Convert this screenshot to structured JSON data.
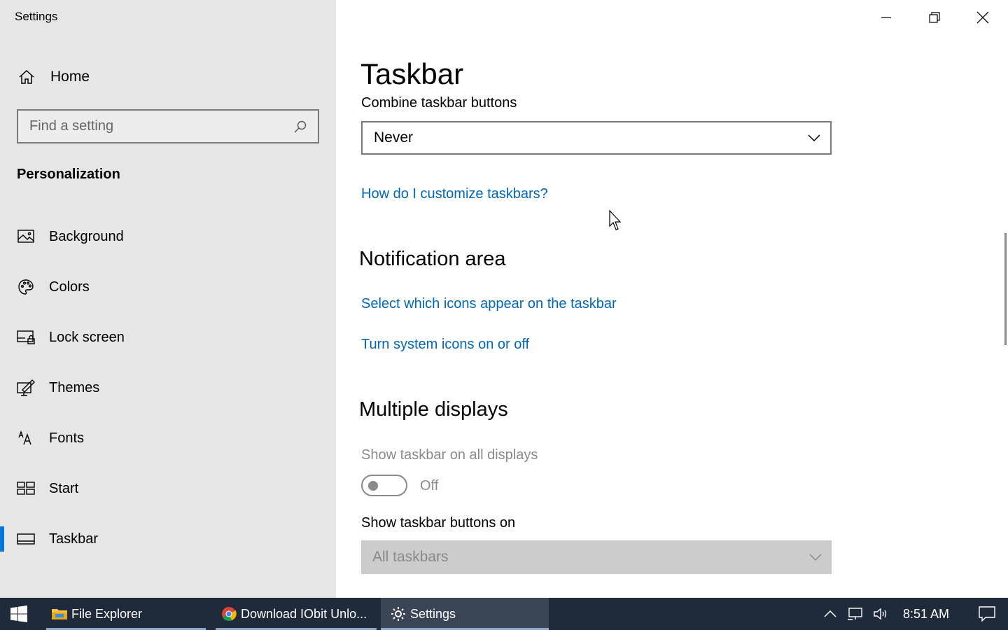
{
  "app": {
    "title": "Settings"
  },
  "sidebar": {
    "home_label": "Home",
    "search_placeholder": "Find a setting",
    "section": "Personalization",
    "items": [
      {
        "label": "Background",
        "icon": "image-icon"
      },
      {
        "label": "Colors",
        "icon": "palette-icon"
      },
      {
        "label": "Lock screen",
        "icon": "lock-screen-icon"
      },
      {
        "label": "Themes",
        "icon": "themes-icon"
      },
      {
        "label": "Fonts",
        "icon": "fonts-icon"
      },
      {
        "label": "Start",
        "icon": "start-icon"
      },
      {
        "label": "Taskbar",
        "icon": "taskbar-icon",
        "active": true
      }
    ]
  },
  "main": {
    "title": "Taskbar",
    "combine_label": "Combine taskbar buttons",
    "combine_value": "Never",
    "customize_link": "How do I customize taskbars?",
    "notification_heading": "Notification area",
    "select_icons_link": "Select which icons appear on the taskbar",
    "system_icons_link": "Turn system icons on or off",
    "multiple_heading": "Multiple displays",
    "show_all_label": "Show taskbar on all displays",
    "show_all_state": "Off",
    "buttons_on_label": "Show taskbar buttons on",
    "buttons_on_value": "All taskbars"
  },
  "taskbar": {
    "apps": [
      {
        "label": "File Explorer",
        "icon": "folder-icon"
      },
      {
        "label": "Download IObit Unlo...",
        "icon": "chrome-icon"
      },
      {
        "label": "Settings",
        "icon": "gear-icon",
        "active": true
      }
    ],
    "time": "8:51 AM"
  },
  "colors": {
    "accent": "#0078d7",
    "link": "#0067b8",
    "taskbar": "#1f2a3a"
  }
}
